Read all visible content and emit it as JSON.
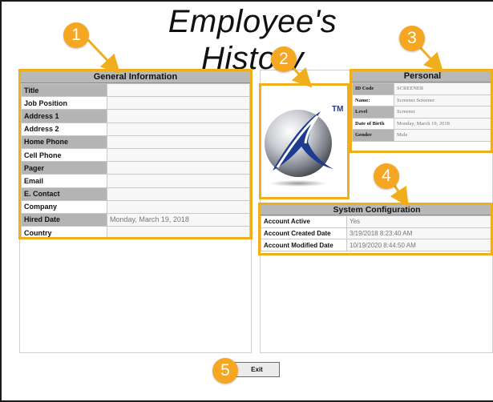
{
  "title": "Employee's History",
  "callouts": [
    "1",
    "2",
    "3",
    "4",
    "5"
  ],
  "general_info": {
    "heading": "General Information",
    "rows": [
      {
        "label": "Title",
        "value": ""
      },
      {
        "label": "Job Position",
        "value": ""
      },
      {
        "label": "Address 1",
        "value": ""
      },
      {
        "label": "Address 2",
        "value": ""
      },
      {
        "label": "Home Phone",
        "value": ""
      },
      {
        "label": "Cell Phone",
        "value": ""
      },
      {
        "label": "Pager",
        "value": ""
      },
      {
        "label": "Email",
        "value": ""
      },
      {
        "label": "E. Contact",
        "value": ""
      },
      {
        "label": "Company",
        "value": ""
      },
      {
        "label": "Hired Date",
        "value": "Monday, March 19, 2018"
      },
      {
        "label": "Country",
        "value": ""
      }
    ]
  },
  "logo": {
    "trademark": "TM",
    "icon": "company-sphere-logo"
  },
  "personal": {
    "heading": "Personal",
    "rows": [
      {
        "label": "ID Code",
        "value": "SCREENER"
      },
      {
        "label": "Name:",
        "value": "Screener Screener"
      },
      {
        "label": "Level",
        "value": "Screener"
      },
      {
        "label": "Date of Birth",
        "value": "Monday, March 19, 2018"
      },
      {
        "label": "Gender",
        "value": "Male"
      }
    ]
  },
  "system_config": {
    "heading": "System Configuration",
    "rows": [
      {
        "label": "Account Active",
        "value": "Yes"
      },
      {
        "label": "Account Created Date",
        "value": "3/19/2018 8:23:40 AM"
      },
      {
        "label": "Account Modified Date",
        "value": "10/19/2020 8:44:50 AM"
      }
    ]
  },
  "exit_label": "Exit",
  "colors": {
    "callout": "#f5a623",
    "highlight": "#f0ad1c",
    "section_header": "#b8b8b8",
    "label_shade": "#b4b4b4"
  }
}
